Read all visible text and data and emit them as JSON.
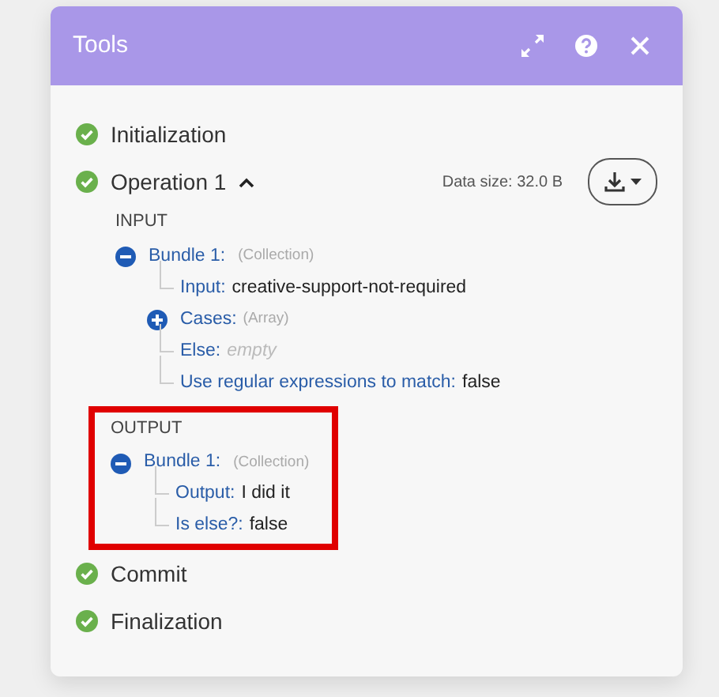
{
  "panel": {
    "title": "Tools"
  },
  "steps": [
    {
      "label": "Initialization",
      "done": true
    },
    {
      "label": "Operation 1",
      "done": true,
      "expanded": true,
      "data_size": "Data size: 32.0 B",
      "sections": [
        {
          "heading": "INPUT",
          "highlighted": false,
          "bundles": [
            {
              "label": "Bundle 1:",
              "type": "(Collection)",
              "expanded": true,
              "items": [
                {
                  "kind": "field",
                  "key": "Input:",
                  "value": "creative-support-not-required"
                },
                {
                  "kind": "array",
                  "key": "Cases:",
                  "type": "(Array)",
                  "expanded": false
                },
                {
                  "kind": "empty",
                  "key": "Else:",
                  "value": "empty"
                },
                {
                  "kind": "field",
                  "key": "Use regular expressions to match:",
                  "value": "false"
                }
              ]
            }
          ]
        },
        {
          "heading": "OUTPUT",
          "highlighted": true,
          "bundles": [
            {
              "label": "Bundle 1:",
              "type": "(Collection)",
              "expanded": true,
              "items": [
                {
                  "kind": "field",
                  "key": "Output:",
                  "value": "I did it"
                },
                {
                  "kind": "field",
                  "key": "Is else?:",
                  "value": "false"
                }
              ]
            }
          ]
        }
      ]
    },
    {
      "label": "Commit",
      "done": true
    },
    {
      "label": "Finalization",
      "done": true
    }
  ]
}
